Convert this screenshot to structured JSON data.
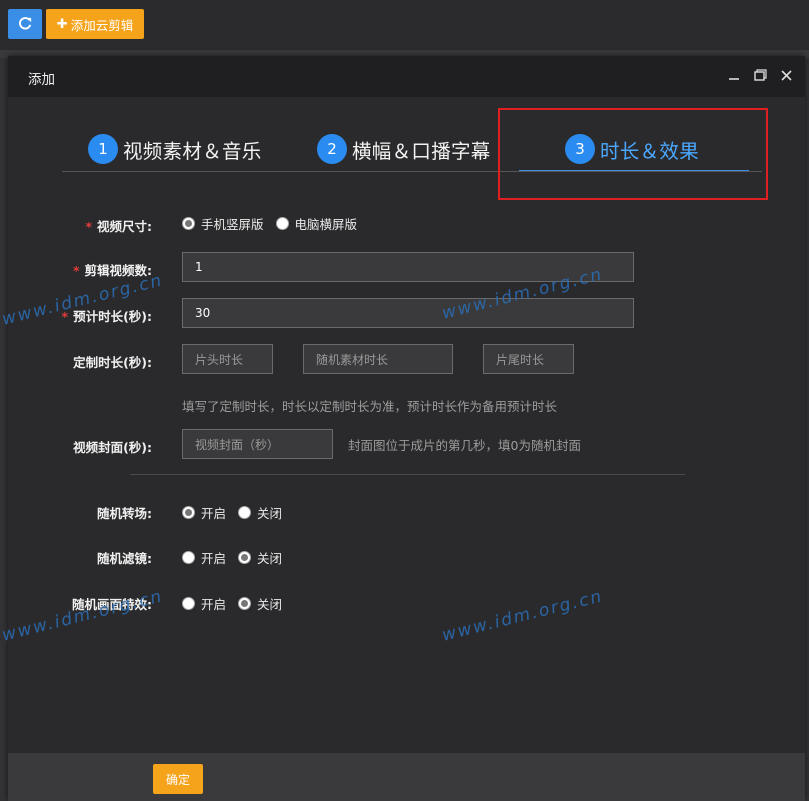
{
  "toolbar": {
    "refresh_icon": "refresh-icon",
    "add_cloud_label": "添加云剪辑"
  },
  "modal": {
    "title": "添加",
    "controls": [
      "minimize-icon",
      "maximize-icon",
      "close-icon"
    ]
  },
  "steps": [
    {
      "num": "1",
      "label": "视频素材＆音乐"
    },
    {
      "num": "2",
      "label": "横幅＆口播字幕"
    },
    {
      "num": "3",
      "label": "时长＆效果"
    }
  ],
  "form": {
    "video_size": {
      "label": "视频尺寸:",
      "options": [
        "手机竖屏版",
        "电脑横屏版"
      ],
      "selected": "手机竖屏版"
    },
    "clip_count": {
      "label": "剪辑视频数:",
      "value": "1"
    },
    "est_duration": {
      "label": "预计时长(秒):",
      "value": "30"
    },
    "custom_duration": {
      "label": "定制时长(秒):",
      "head_placeholder": "片头时长",
      "random_placeholder": "随机素材时长",
      "tail_placeholder": "片尾时长",
      "hint": "填写了定制时长，时长以定制时长为准，预计时长作为备用预计时长"
    },
    "cover": {
      "label": "视频封面(秒):",
      "placeholder": "视频封面（秒）",
      "hint": "封面图位于成片的第几秒，填0为随机封面"
    },
    "random_transition": {
      "label": "随机转场:",
      "options": [
        "开启",
        "关闭"
      ],
      "selected": "开启"
    },
    "random_filter": {
      "label": "随机滤镜:",
      "options": [
        "开启",
        "关闭"
      ],
      "selected": "关闭"
    },
    "random_effect": {
      "label": "随机画面特效:",
      "options": [
        "开启",
        "关闭"
      ],
      "selected": "关闭"
    }
  },
  "footer": {
    "confirm_label": "确定"
  },
  "watermark": "www.idm.org.cn",
  "colors": {
    "accent_blue": "#2a8cf0",
    "accent_orange": "#f5a31a",
    "highlight_red": "#e02020"
  }
}
